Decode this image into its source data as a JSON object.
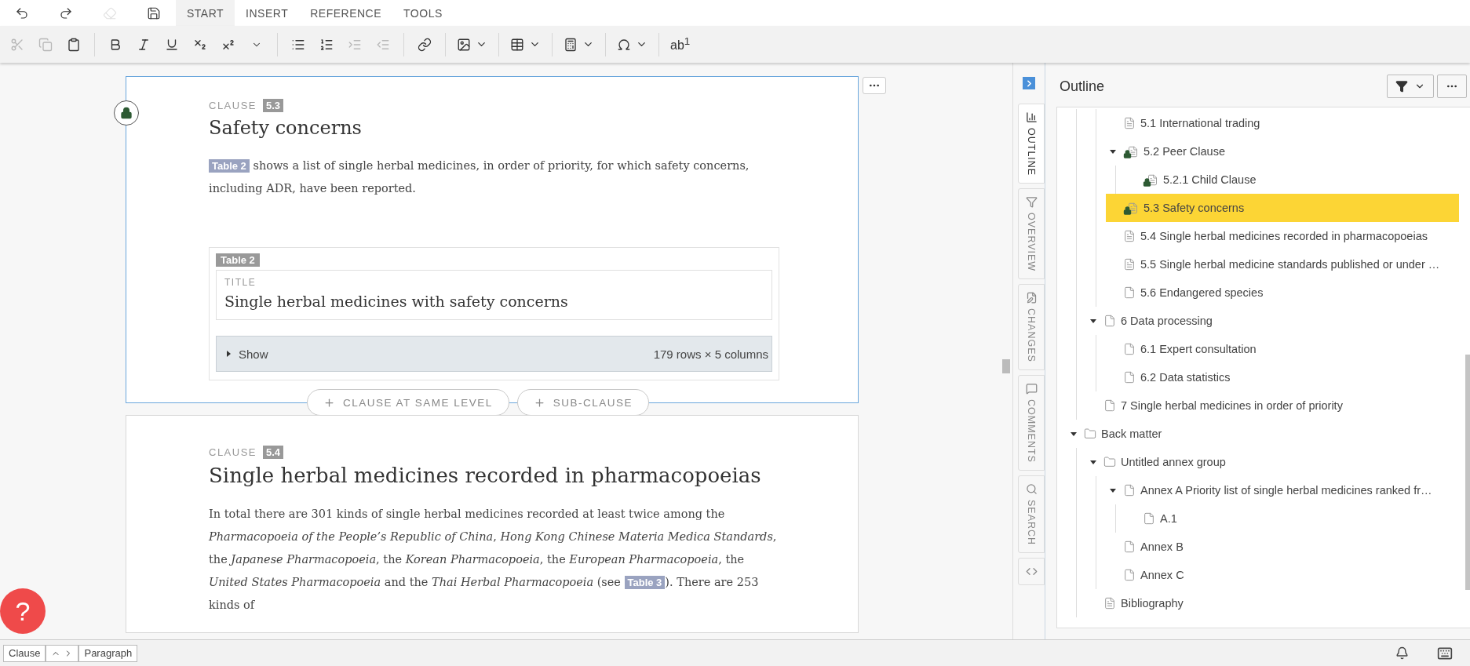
{
  "top_bar": {
    "quick_actions": [
      {
        "disabled": false
      },
      {
        "disabled": false
      },
      {
        "disabled": true
      },
      {
        "disabled": false
      }
    ],
    "tabs": [
      {
        "label": "START",
        "selected": true
      },
      {
        "label": "INSERT",
        "selected": false
      },
      {
        "label": "REFERENCE",
        "selected": false
      },
      {
        "label": "TOOLS",
        "selected": false
      }
    ]
  },
  "format_bar": {
    "buttons": [
      {
        "disabled": true
      },
      {
        "disabled": true
      },
      {
        "disabled": false
      },
      {
        "disabled": false
      },
      {
        "disabled": false
      },
      {
        "disabled": false
      },
      {
        "disabled": false
      },
      {
        "disabled": false
      },
      {
        "disabled": false
      },
      {
        "disabled": false
      },
      {
        "disabled": false
      },
      {
        "disabled": true
      },
      {
        "disabled": true
      },
      {
        "disabled": false
      },
      {
        "disabled": false
      },
      {
        "disabled": false
      },
      {
        "disabled": false
      },
      {
        "disabled": false
      },
      {
        "disabled": false
      }
    ],
    "text_button": "ab$^{1}$"
  },
  "clauses": [
    {
      "label": "CLAUSE",
      "number": "5.3",
      "title": "Safety concerns",
      "locked": true,
      "selected": true,
      "paragraph": [
        {
          "kind": "ref",
          "text": "Table 2"
        },
        {
          "kind": "text",
          "text": " shows a list of single herbal medicines, in order of priority, for which safety concerns, including ADR, have been reported."
        }
      ],
      "table": {
        "tag": "Table 2",
        "field_label": "TITLE",
        "title": "Single herbal medicines with safety concerns",
        "toggle": "Show",
        "expanded": false,
        "summary": "179 rows × 5 columns"
      },
      "add_buttons": [
        "CLAUSE AT SAME LEVEL",
        "SUB-CLAUSE"
      ]
    },
    {
      "label": "CLAUSE",
      "number": "5.4",
      "title": "Single herbal medicines recorded in pharmacopoeias",
      "locked": false,
      "selected": false,
      "paragraph": [
        {
          "kind": "text",
          "text": "In total there are 301 kinds of single herbal medicines recorded at least twice among the *Pharmacopoeia of the People’s Republic of China*, *Hong Kong Chinese Materia Medica Standards*, the *Japanese Pharmacopoeia*, the *Korean Pharmacopoeia*, the *European Pharmacopoeia*, the *United States Pharmacopoeia* and the *Thai Herbal Pharmacopoeia* (see "
        },
        {
          "kind": "ref",
          "text": "Table 3"
        },
        {
          "kind": "text",
          "text": "). There are 253 kinds of"
        }
      ]
    }
  ],
  "help_button": "?",
  "sidebar": {
    "tabs": [
      {
        "label": "OUTLINE",
        "selected": true
      },
      {
        "label": "OVERVIEW",
        "selected": false
      },
      {
        "label": "CHANGES",
        "selected": false
      },
      {
        "label": "COMMENTS",
        "selected": false
      },
      {
        "label": "SEARCH",
        "selected": false
      },
      {
        "selected": false
      }
    ]
  },
  "outline": {
    "title": "Outline",
    "items": [
      {
        "children": [
          {
            "children": [
              {
                "label": "5.1 International trading",
                "kind": "lines",
                "selected": false
              },
              {
                "label": "5.2 Peer Clause",
                "kind": "locked",
                "selected": false,
                "expanded": true,
                "children": [
                  {
                    "label": "5.2.1 Child Clause",
                    "kind": "locked",
                    "selected": false
                  }
                ]
              },
              {
                "label": "5.3 Safety concerns",
                "kind": "locked",
                "selected": true
              },
              {
                "label": "5.4 Single herbal medicines recorded in pharmacopoeias",
                "kind": "lines",
                "selected": false
              },
              {
                "label": "5.5 Single herbal medicine standards published or under …",
                "kind": "lines",
                "selected": false
              },
              {
                "label": "5.6 Endangered species",
                "kind": "blank",
                "selected": false
              }
            ]
          },
          {
            "label": "6 Data processing",
            "kind": "blank",
            "selected": false,
            "expanded": true,
            "children": [
              {
                "label": "6.1 Expert consultation",
                "kind": "blank",
                "selected": false
              },
              {
                "label": "6.2 Data statistics",
                "kind": "blank",
                "selected": false
              }
            ]
          },
          {
            "label": "7 Single herbal medicines in order of priority",
            "kind": "blank",
            "selected": false
          }
        ]
      },
      {
        "label": "Back matter",
        "kind": "folder",
        "selected": false,
        "expanded": true,
        "children": [
          {
            "label": "Untitled annex group",
            "kind": "folder",
            "selected": false,
            "expanded": true,
            "children": [
              {
                "label": "Annex A Priority list of single herbal medicines ranked fr…",
                "kind": "blank",
                "selected": false,
                "expanded": true,
                "children": [
                  {
                    "label": "A.1",
                    "kind": "blank",
                    "selected": false
                  }
                ]
              },
              {
                "label": "Annex B",
                "kind": "blank",
                "selected": false
              },
              {
                "label": "Annex C",
                "kind": "blank",
                "selected": false
              }
            ]
          },
          {
            "label": "Bibliography",
            "kind": "lines",
            "selected": false
          }
        ]
      }
    ]
  },
  "status_bar": {
    "breadcrumb": [
      "Clause",
      "Paragraph"
    ]
  }
}
